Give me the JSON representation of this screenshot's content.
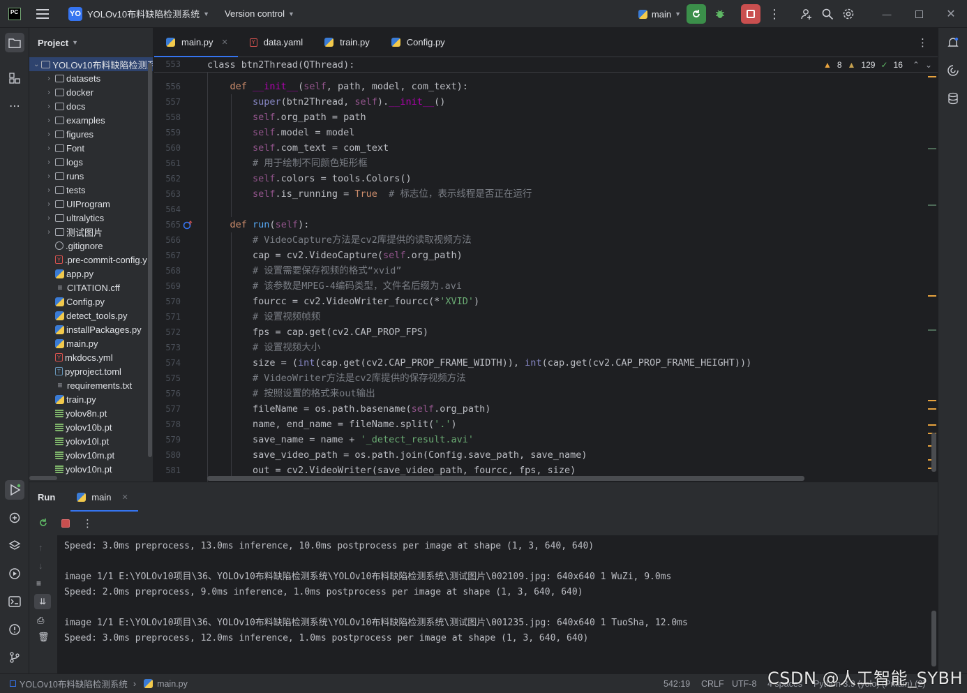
{
  "titlebar": {
    "project_badge": "YO",
    "project_name": "YOLOv10布料缺陷检测系统",
    "vcs_label": "Version control",
    "run_config": "main"
  },
  "project_panel": {
    "title": "Project",
    "root_label": "YOLOv10布料缺陷检测系",
    "items": [
      {
        "label": "datasets",
        "type": "folder"
      },
      {
        "label": "docker",
        "type": "folder"
      },
      {
        "label": "docs",
        "type": "folder"
      },
      {
        "label": "examples",
        "type": "folder"
      },
      {
        "label": "figures",
        "type": "folder"
      },
      {
        "label": "Font",
        "type": "folder"
      },
      {
        "label": "logs",
        "type": "folder"
      },
      {
        "label": "runs",
        "type": "folder"
      },
      {
        "label": "tests",
        "type": "folder"
      },
      {
        "label": "UIProgram",
        "type": "folder"
      },
      {
        "label": "ultralytics",
        "type": "folder"
      },
      {
        "label": "测试图片",
        "type": "folder"
      },
      {
        "label": ".gitignore",
        "type": "ignore"
      },
      {
        "label": ".pre-commit-config.y",
        "type": "yml"
      },
      {
        "label": "app.py",
        "type": "py"
      },
      {
        "label": "CITATION.cff",
        "type": "txt"
      },
      {
        "label": "Config.py",
        "type": "py"
      },
      {
        "label": "detect_tools.py",
        "type": "py"
      },
      {
        "label": "installPackages.py",
        "type": "py"
      },
      {
        "label": "main.py",
        "type": "py"
      },
      {
        "label": "mkdocs.yml",
        "type": "yml"
      },
      {
        "label": "pyproject.toml",
        "type": "toml"
      },
      {
        "label": "requirements.txt",
        "type": "txt"
      },
      {
        "label": "train.py",
        "type": "py"
      },
      {
        "label": "yolov8n.pt",
        "type": "pt"
      },
      {
        "label": "yolov10b.pt",
        "type": "pt"
      },
      {
        "label": "yolov10l.pt",
        "type": "pt"
      },
      {
        "label": "yolov10m.pt",
        "type": "pt"
      },
      {
        "label": "yolov10n.pt",
        "type": "pt"
      }
    ]
  },
  "editor": {
    "tabs": [
      {
        "label": "main.py",
        "icon": "python-icon",
        "active": true
      },
      {
        "label": "data.yaml",
        "icon": "yaml-icon",
        "active": false
      },
      {
        "label": "train.py",
        "icon": "python-icon",
        "active": false
      },
      {
        "label": "Config.py",
        "icon": "python-icon",
        "active": false
      }
    ],
    "inspections": {
      "warnings": "8",
      "weak_warnings": "129",
      "typos": "16"
    },
    "sticky_line": {
      "number": "553",
      "text": "class btn2Thread(QThread):"
    },
    "lines": [
      {
        "n": "556",
        "segs": [
          [
            "    ",
            ""
          ],
          [
            "def ",
            "kw"
          ],
          [
            "__init__",
            "mg"
          ],
          [
            "(",
            ""
          ],
          [
            "self",
            "self"
          ],
          [
            ", path, model, com_text):",
            ""
          ]
        ]
      },
      {
        "n": "557",
        "segs": [
          [
            "        ",
            ""
          ],
          [
            "super",
            "bi"
          ],
          [
            "(btn2Thread, ",
            ""
          ],
          [
            "self",
            "self"
          ],
          [
            ").",
            ""
          ],
          [
            "__init__",
            "mg"
          ],
          [
            "()",
            ""
          ]
        ]
      },
      {
        "n": "558",
        "segs": [
          [
            "        ",
            ""
          ],
          [
            "self",
            "self"
          ],
          [
            ".org_path = path",
            ""
          ]
        ]
      },
      {
        "n": "559",
        "segs": [
          [
            "        ",
            ""
          ],
          [
            "self",
            "self"
          ],
          [
            ".model = model",
            ""
          ]
        ]
      },
      {
        "n": "560",
        "segs": [
          [
            "        ",
            ""
          ],
          [
            "self",
            "self"
          ],
          [
            ".com_text = com_text",
            ""
          ]
        ]
      },
      {
        "n": "561",
        "segs": [
          [
            "        ",
            ""
          ],
          [
            "# 用于绘制不同颜色矩形框",
            "cmt"
          ]
        ]
      },
      {
        "n": "562",
        "segs": [
          [
            "        ",
            ""
          ],
          [
            "self",
            "self"
          ],
          [
            ".colors = tools.Colors()",
            ""
          ]
        ]
      },
      {
        "n": "563",
        "segs": [
          [
            "        ",
            ""
          ],
          [
            "self",
            "self"
          ],
          [
            ".is_running = ",
            ""
          ],
          [
            "True",
            "kw"
          ],
          [
            "  ",
            ""
          ],
          [
            "# 标志位，表示线程是否正在运行",
            "cmt"
          ]
        ]
      },
      {
        "n": "564",
        "segs": [
          [
            "",
            ""
          ]
        ]
      },
      {
        "n": "565",
        "segs": [
          [
            "    ",
            ""
          ],
          [
            "def ",
            "kw"
          ],
          [
            "run",
            "fn"
          ],
          [
            "(",
            ""
          ],
          [
            "self",
            "self"
          ],
          [
            "):",
            ""
          ]
        ]
      },
      {
        "n": "566",
        "segs": [
          [
            "        ",
            ""
          ],
          [
            "# VideoCapture方法是cv2库提供的读取视频方法",
            "cmt"
          ]
        ]
      },
      {
        "n": "567",
        "segs": [
          [
            "        cap = cv2.VideoCapture(",
            ""
          ],
          [
            "self",
            "self"
          ],
          [
            ".org_path)",
            ""
          ]
        ]
      },
      {
        "n": "568",
        "segs": [
          [
            "        ",
            ""
          ],
          [
            "# 设置需要保存视频的格式“xvid”",
            "cmt"
          ]
        ]
      },
      {
        "n": "569",
        "segs": [
          [
            "        ",
            ""
          ],
          [
            "# 该参数是MPEG-4编码类型，文件名后缀为.avi",
            "cmt"
          ]
        ]
      },
      {
        "n": "570",
        "segs": [
          [
            "        fourcc = cv2.VideoWriter_fourcc(*",
            ""
          ],
          [
            "'XVID'",
            "str"
          ],
          [
            ")",
            ""
          ]
        ]
      },
      {
        "n": "571",
        "segs": [
          [
            "        ",
            ""
          ],
          [
            "# 设置视频帧频",
            "cmt"
          ]
        ]
      },
      {
        "n": "572",
        "segs": [
          [
            "        fps = cap.get(cv2.CAP_PROP_FPS)",
            ""
          ]
        ]
      },
      {
        "n": "573",
        "segs": [
          [
            "        ",
            ""
          ],
          [
            "# 设置视频大小",
            "cmt"
          ]
        ]
      },
      {
        "n": "574",
        "segs": [
          [
            "        size = (",
            ""
          ],
          [
            "int",
            "bi"
          ],
          [
            "(cap.get(cv2.CAP_PROP_FRAME_WIDTH)), ",
            ""
          ],
          [
            "int",
            "bi"
          ],
          [
            "(cap.get(cv2.CAP_PROP_FRAME_HEIGHT)))",
            ""
          ]
        ]
      },
      {
        "n": "575",
        "segs": [
          [
            "        ",
            ""
          ],
          [
            "# VideoWriter方法是cv2库提供的保存视频方法",
            "cmt"
          ]
        ]
      },
      {
        "n": "576",
        "segs": [
          [
            "        ",
            ""
          ],
          [
            "# 按照设置的格式来out输出",
            "cmt"
          ]
        ]
      },
      {
        "n": "577",
        "segs": [
          [
            "        fileName = os.path.basename(",
            ""
          ],
          [
            "self",
            "self"
          ],
          [
            ".org_path)",
            ""
          ]
        ]
      },
      {
        "n": "578",
        "segs": [
          [
            "        name, end_name = fileName.split(",
            ""
          ],
          [
            "'.'",
            "str"
          ],
          [
            ")",
            ""
          ]
        ]
      },
      {
        "n": "579",
        "segs": [
          [
            "        save_name = name + ",
            ""
          ],
          [
            "'_detect_result.avi'",
            "str"
          ]
        ]
      },
      {
        "n": "580",
        "segs": [
          [
            "        save_video_path = os.path.join(Config.save_path, save_name)",
            ""
          ]
        ]
      },
      {
        "n": "581",
        "segs": [
          [
            "        out = cv2.VideoWriter(save_video_path, fourcc, fps, size)",
            ""
          ]
        ]
      }
    ]
  },
  "run_panel": {
    "title": "Run",
    "tab_label": "main",
    "console_lines": [
      "Speed: 3.0ms preprocess, 13.0ms inference, 10.0ms postprocess per image at shape (1, 3, 640, 640)",
      "",
      "image 1/1 E:\\YOLOv10项目\\36、YOLOv10布料缺陷检测系统\\YOLOv10布料缺陷检测系统\\测试图片\\002109.jpg: 640x640 1 WuZi, 9.0ms",
      "Speed: 2.0ms preprocess, 9.0ms inference, 1.0ms postprocess per image at shape (1, 3, 640, 640)",
      "",
      "image 1/1 E:\\YOLOv10项目\\36、YOLOv10布料缺陷检测系统\\YOLOv10布料缺陷检测系统\\测试图片\\001235.jpg: 640x640 1 TuoSha, 12.0ms",
      "Speed: 3.0ms preprocess, 12.0ms inference, 1.0ms postprocess per image at shape (1, 3, 640, 640)"
    ]
  },
  "statusbar": {
    "breadcrumb_project": "YOLOv10布料缺陷检测系统",
    "breadcrumb_file": "main.py",
    "position": "542:19",
    "line_sep": "CRLF",
    "encoding": "UTF-8",
    "indent": "4 spaces",
    "interpreter": "Python 3.9 (yolo) (Pmain) (2)"
  },
  "watermark": "CSDN @人工智能_SYBH",
  "colors": {
    "accent": "#3574f0",
    "run_green": "#3b8f4a",
    "stop_red": "#c94f4f",
    "warning": "#e8a33e"
  }
}
